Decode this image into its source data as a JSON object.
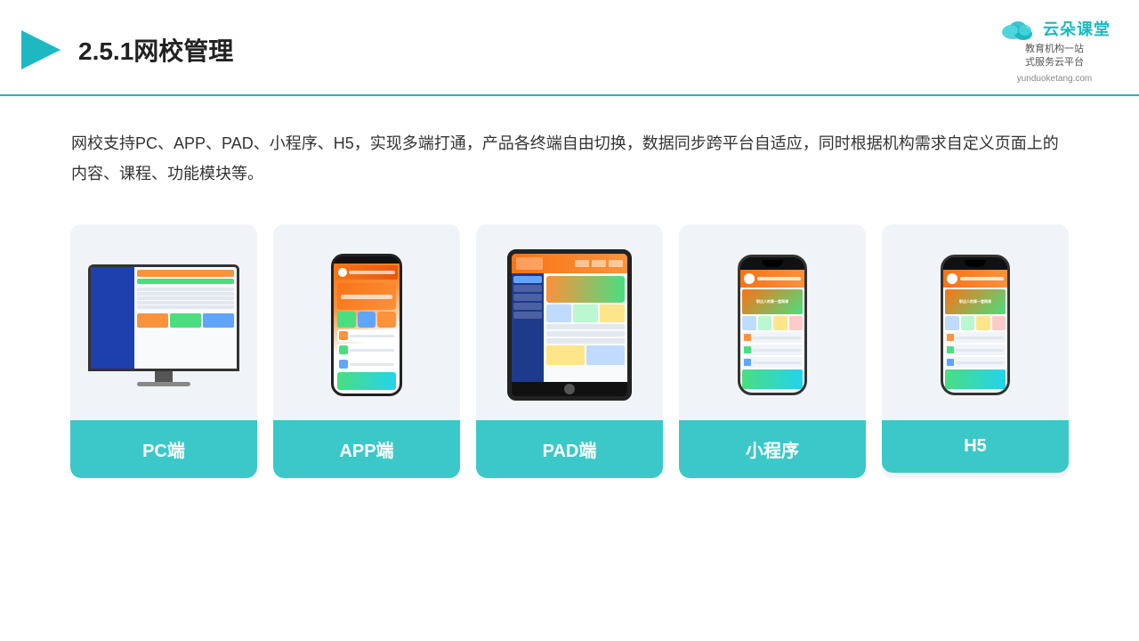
{
  "header": {
    "title": "2.5.1网校管理",
    "brand_name": "云朵课堂",
    "brand_url": "yunduoketang.com",
    "brand_tagline_line1": "教育机构一站",
    "brand_tagline_line2": "式服务云平台"
  },
  "description": {
    "text": "网校支持PC、APP、PAD、小程序、H5，实现多端打通，产品各终端自由切换，数据同步跨平台自适应，同时根据机构需求自定义页面上的内容、课程、功能模块等。"
  },
  "cards": [
    {
      "id": "pc",
      "label": "PC端"
    },
    {
      "id": "app",
      "label": "APP端"
    },
    {
      "id": "pad",
      "label": "PAD端"
    },
    {
      "id": "mini",
      "label": "小程序"
    },
    {
      "id": "h5",
      "label": "H5"
    }
  ],
  "colors": {
    "teal": "#3cc8c8",
    "teal_dark": "#1db8c2",
    "bg_card": "#f0f4f8"
  }
}
